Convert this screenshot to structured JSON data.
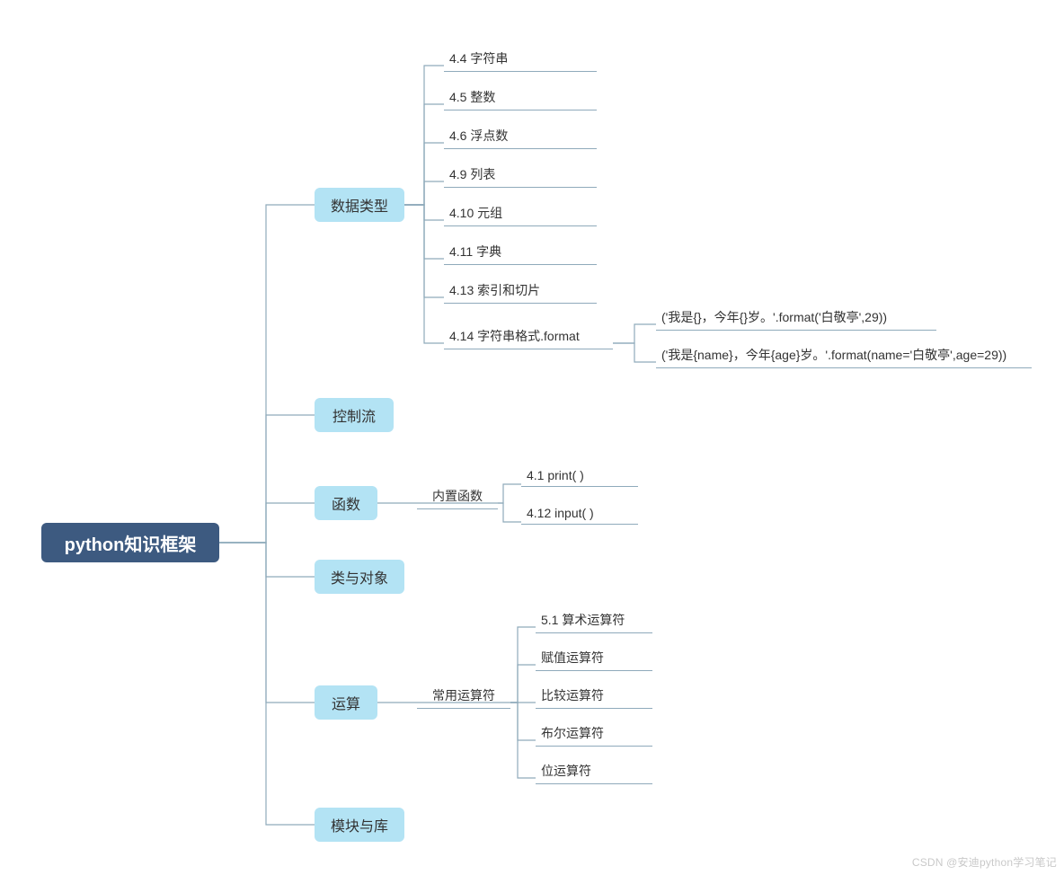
{
  "root": {
    "label": "python知识框架"
  },
  "branches": {
    "data_types": {
      "label": "数据类型"
    },
    "control_flow": {
      "label": "控制流"
    },
    "functions": {
      "label": "函数"
    },
    "classes": {
      "label": "类与对象"
    },
    "operations": {
      "label": "运算"
    },
    "modules": {
      "label": "模块与库"
    }
  },
  "data_types_children": [
    "4.4 字符串",
    "4.5 整数",
    "4.6 浮点数",
    "4.9 列表",
    "4.10 元组",
    "4.11 字典",
    "4.13 索引和切片",
    "4.14 字符串格式.format"
  ],
  "format_examples": [
    "('我是{}，今年{}岁。'.format('白敬亭',29))",
    "('我是{name}，今年{age}岁。'.format(name='白敬亭',age=29))"
  ],
  "functions_mid": {
    "label": "内置函数"
  },
  "functions_children": [
    "4.1 print( )",
    "4.12 input( )"
  ],
  "operations_mid": {
    "label": "常用运算符"
  },
  "operations_children": [
    "5.1 算术运算符",
    "赋值运算符",
    "比较运算符",
    "布尔运算符",
    "位运算符"
  ],
  "watermark": "CSDN @安迪python学习笔记"
}
